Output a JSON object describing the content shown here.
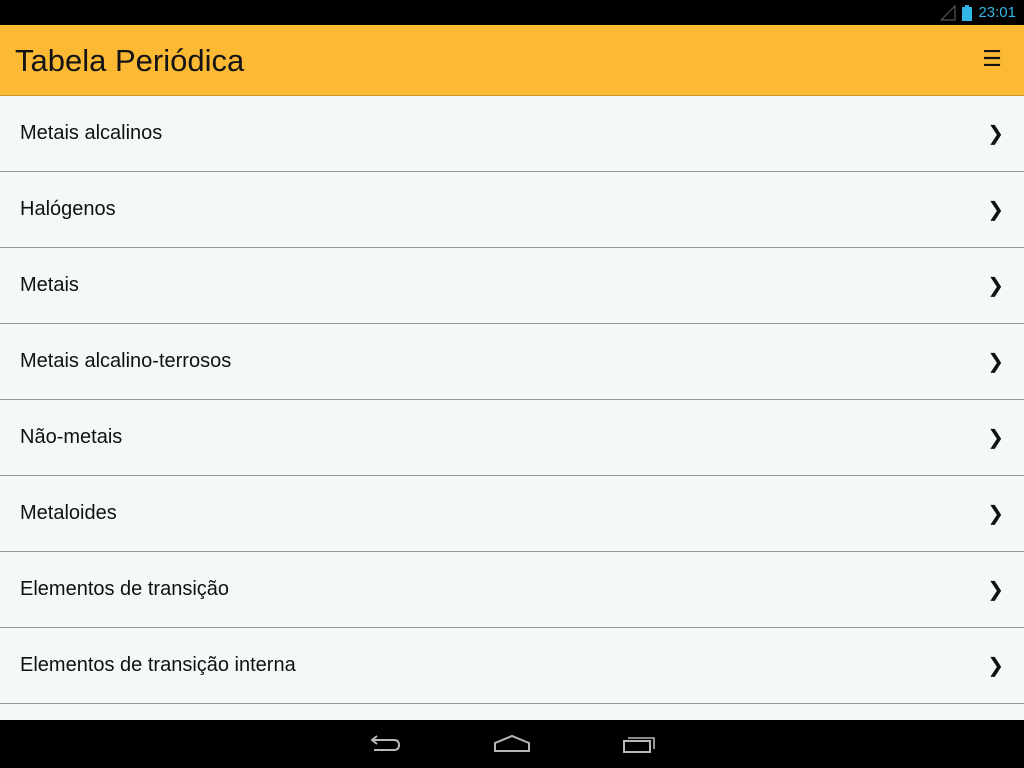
{
  "status_bar": {
    "time": "23:01",
    "signal_icon": "signal-icon",
    "battery_icon": "battery-icon",
    "accent_color": "#33b5e5"
  },
  "app_bar": {
    "title": "Tabela Periódica",
    "menu_icon": "☰",
    "color": "#fbb934"
  },
  "list": {
    "chevron": "❯",
    "items": [
      {
        "label": "Metais alcalinos"
      },
      {
        "label": "Halógenos"
      },
      {
        "label": "Metais"
      },
      {
        "label": "Metais alcalino-terrosos"
      },
      {
        "label": "Não-metais"
      },
      {
        "label": "Metaloides"
      },
      {
        "label": "Elementos de transição"
      },
      {
        "label": "Elementos de transição interna"
      },
      {
        "label": ""
      }
    ]
  },
  "nav_bar": {
    "back_icon": "back-icon",
    "home_icon": "home-icon",
    "recent_icon": "recent-apps-icon"
  }
}
